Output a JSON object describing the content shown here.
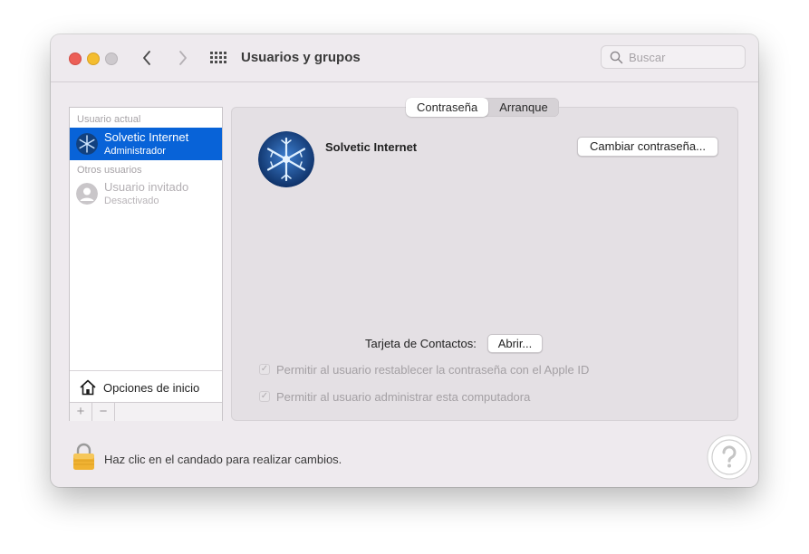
{
  "window": {
    "title": "Usuarios y grupos"
  },
  "search": {
    "placeholder": "Buscar"
  },
  "sidebar": {
    "current_section": "Usuario actual",
    "current_user": {
      "name": "Solvetic Internet",
      "role": "Administrador"
    },
    "others_section": "Otros usuarios",
    "guest_user": {
      "name": "Usuario invitado",
      "role": "Desactivado"
    },
    "login_options": "Opciones de inicio",
    "add": "+",
    "remove": "−"
  },
  "tabs": [
    "Contraseña",
    "Arranque"
  ],
  "profile": {
    "name": "Solvetic Internet",
    "change_password": "Cambiar contraseña..."
  },
  "contacts": {
    "label": "Tarjeta de Contactos:",
    "open": "Abrir..."
  },
  "checkboxes": [
    {
      "label": "Permitir al usuario restablecer la contraseña con el Apple ID",
      "checked": true
    },
    {
      "label": "Permitir al usuario administrar esta computadora",
      "checked": true
    }
  ],
  "footer": {
    "lock_text": "Haz clic en el candado para realizar cambios."
  },
  "colors": {
    "accent": "#0863d8",
    "close": "#ec5f57",
    "minimize": "#f4bd2f",
    "lock": "#f0b232"
  },
  "icons": [
    "chevron-left-icon",
    "chevron-right-icon",
    "grid-icon",
    "search-icon",
    "snowflake-avatar-icon",
    "guest-avatar-icon",
    "home-icon",
    "lock-icon",
    "help-badge-icon"
  ]
}
